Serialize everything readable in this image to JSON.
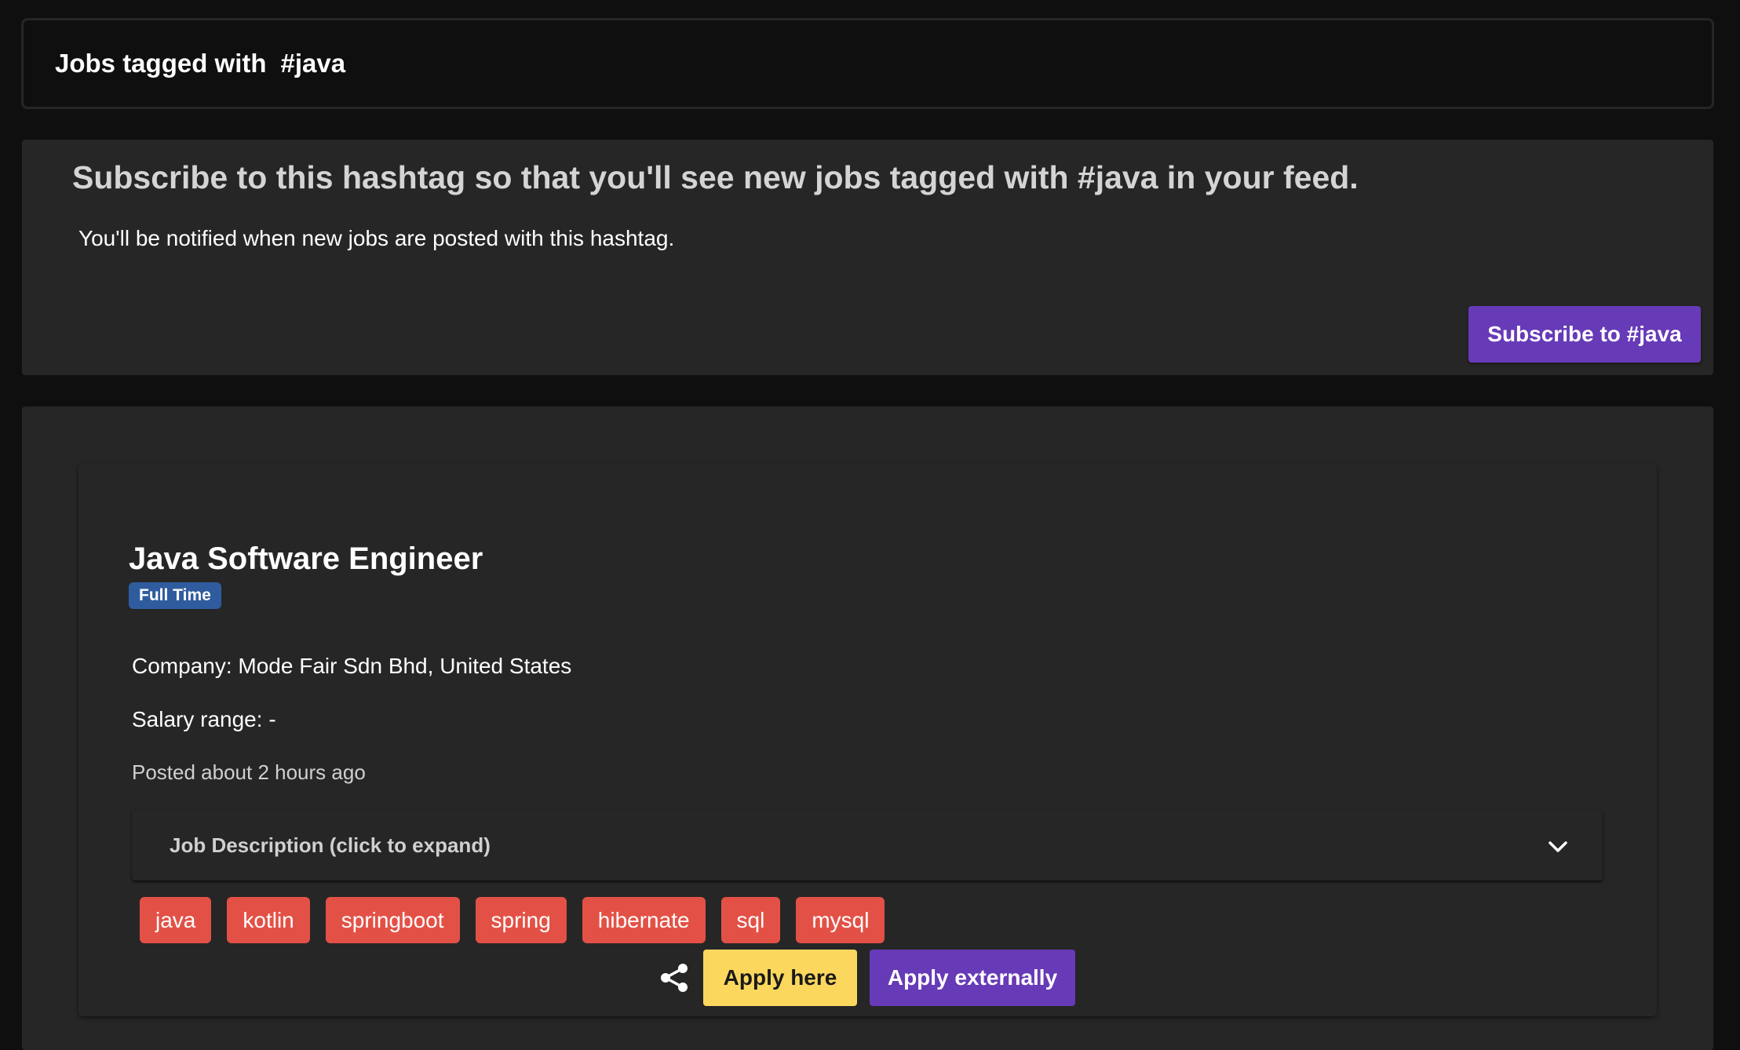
{
  "header": {
    "prefix": "Jobs tagged with",
    "hashtag": "#java"
  },
  "subscribe": {
    "title": "Subscribe to this hashtag so that you'll see new jobs tagged with #java in your feed.",
    "text": "You'll be notified when new jobs are posted with this hashtag.",
    "button_label": "Subscribe to #java"
  },
  "job": {
    "title": "Java Software Engineer",
    "type": "Full Time",
    "company": "Company: Mode Fair Sdn Bhd, United States",
    "salary": "Salary range: -",
    "posted": "Posted about 2 hours ago",
    "description_label": "Job Description (click to expand)",
    "tags": [
      "java",
      "kotlin",
      "springboot",
      "spring",
      "hibernate",
      "sql",
      "mysql"
    ],
    "apply_here_label": "Apply here",
    "apply_external_label": "Apply externally",
    "share_icon": "share-icon",
    "expand_icon": "chevron-down-icon"
  },
  "colors": {
    "background": "#0f0f0f",
    "card": "#262626",
    "primary": "#673ab7",
    "tag": "#e35146",
    "job_type_badge": "#2f5c9e",
    "apply_here": "#fbd85d"
  }
}
